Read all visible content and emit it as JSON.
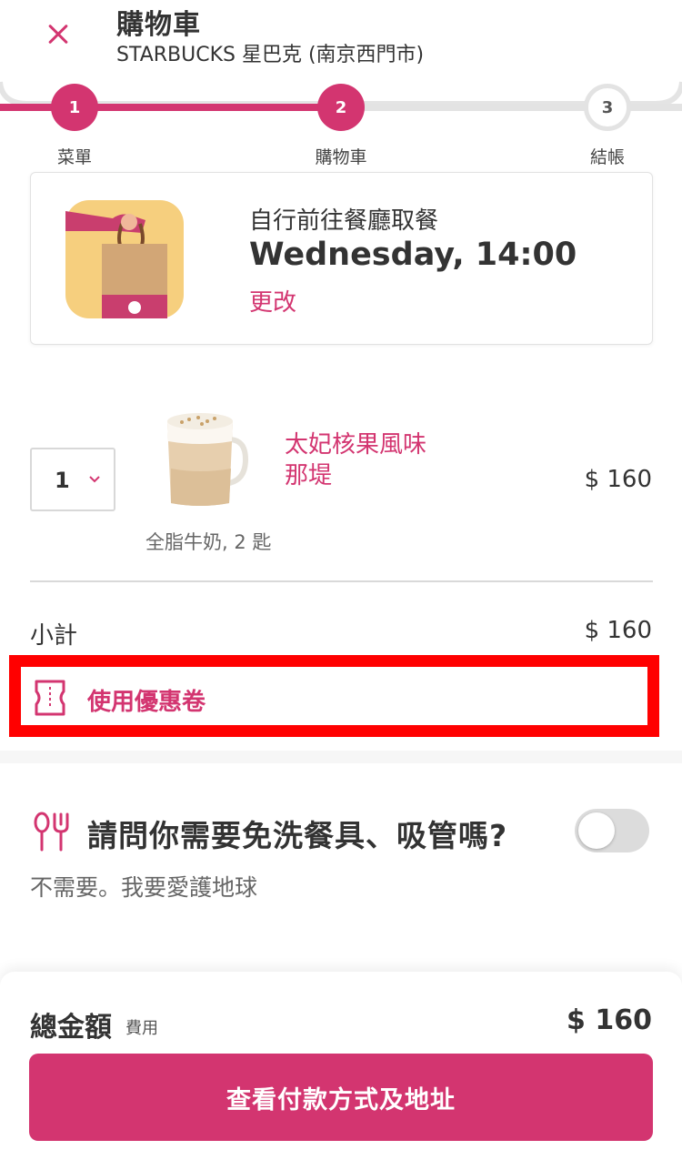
{
  "header": {
    "title": "購物車",
    "store": "STARBUCKS 星巴克 (南京西門市)"
  },
  "stepper": {
    "steps": [
      {
        "number": "1",
        "label": "菜單",
        "state": "done"
      },
      {
        "number": "2",
        "label": "購物車",
        "state": "active"
      },
      {
        "number": "3",
        "label": "結帳",
        "state": "pending"
      }
    ]
  },
  "pickup": {
    "mode": "自行前往餐廳取餐",
    "time": "Wednesday, 14:00",
    "change_label": "更改"
  },
  "cart": {
    "items": [
      {
        "quantity": "1",
        "name": "太妃核果風味那堤",
        "price": "$ 160",
        "options": "全脂牛奶, 2 匙"
      }
    ]
  },
  "subtotal": {
    "label": "小計",
    "value": "$ 160"
  },
  "coupon": {
    "label": "使用優惠卷"
  },
  "cutlery": {
    "question": "請問你需要免洗餐具、吸管嗎?",
    "description": "不需要。我要愛護地球",
    "toggle_on": false
  },
  "footer": {
    "total_label": "總金額",
    "fee_label": "費用",
    "total_value": "$ 160",
    "checkout_label": "查看付款方式及地址"
  },
  "colors": {
    "brand": "#d33570",
    "highlight": "#ff0000"
  }
}
